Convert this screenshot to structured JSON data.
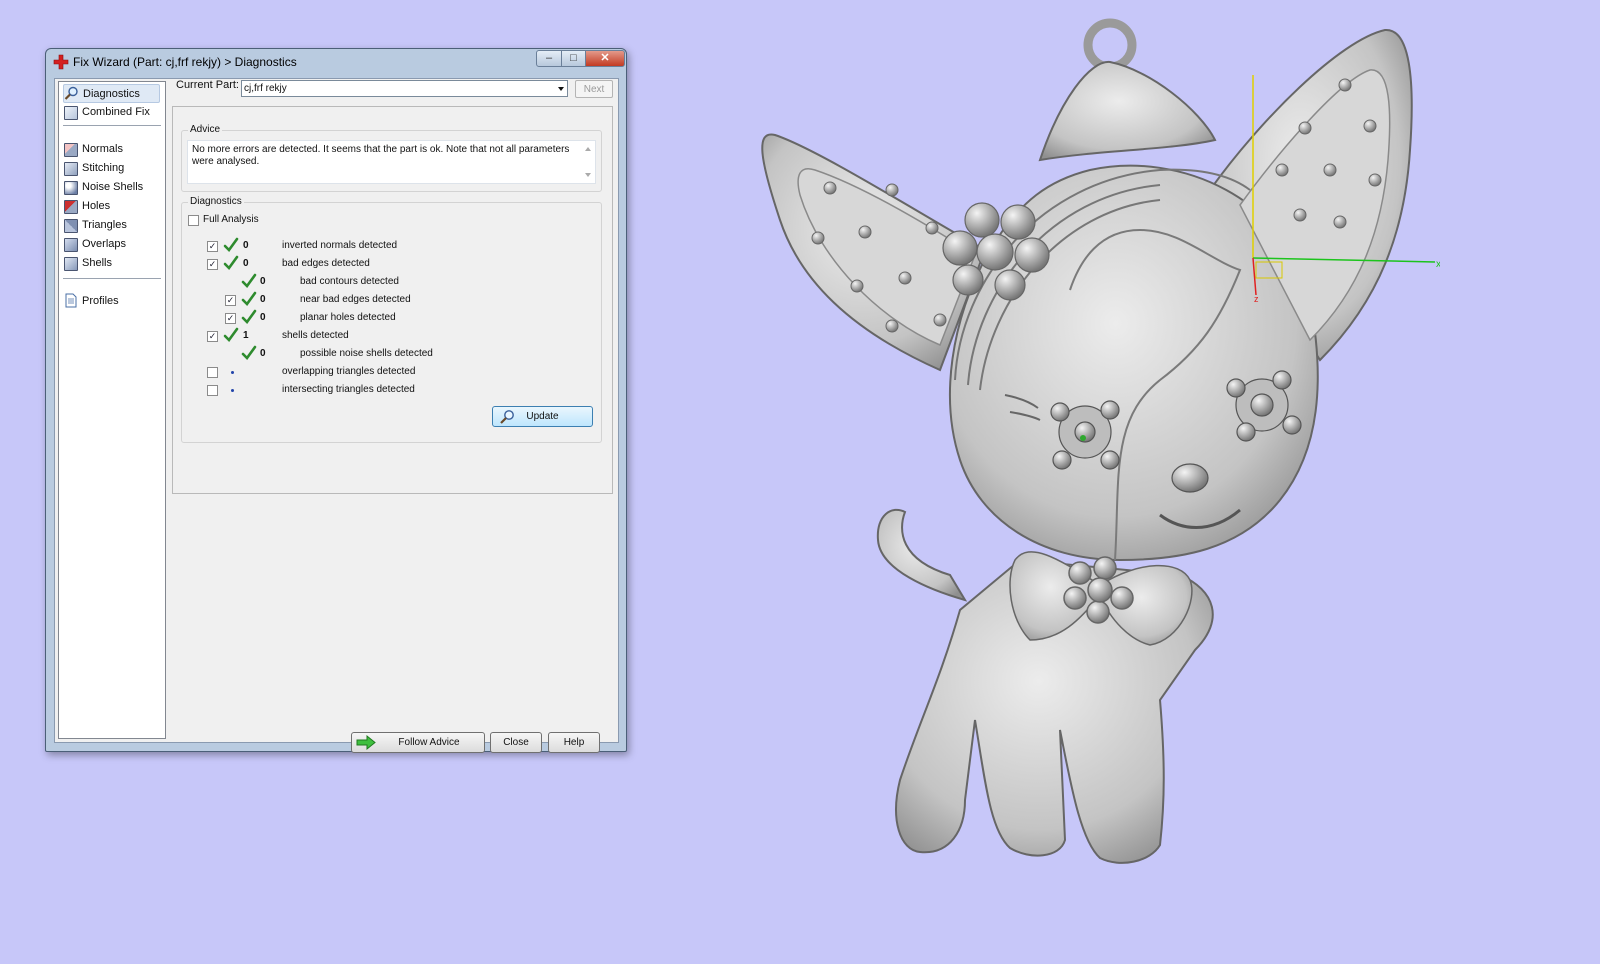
{
  "window": {
    "title": "Fix Wizard (Part: cj,frf rekjy) > Diagnostics",
    "min_label": "–",
    "max_label": "□",
    "close_label": "✕"
  },
  "nav": {
    "items": [
      {
        "label": "Diagnostics",
        "icon": "magnifier-icon",
        "selected": true
      },
      {
        "label": "Combined Fix",
        "icon": "cube-icon"
      },
      {
        "label": "Normals",
        "icon": "normals-cube-icon"
      },
      {
        "label": "Stitching",
        "icon": "stitching-cube-icon"
      },
      {
        "label": "Noise Shells",
        "icon": "noise-shells-icon"
      },
      {
        "label": "Holes",
        "icon": "holes-cube-icon"
      },
      {
        "label": "Triangles",
        "icon": "triangles-cube-icon"
      },
      {
        "label": "Overlaps",
        "icon": "overlaps-cube-icon"
      },
      {
        "label": "Shells",
        "icon": "shells-cube-icon"
      },
      {
        "label": "Profiles",
        "icon": "document-icon"
      }
    ]
  },
  "current_part": {
    "label": "Current Part:",
    "value": "cj,frf rekjy",
    "next_label": "Next"
  },
  "advice": {
    "title": "Advice",
    "text": "No more errors are detected. It seems that the part is ok. Note that not all parameters were analysed."
  },
  "diagnostics": {
    "title": "Diagnostics",
    "full_analysis_label": "Full Analysis",
    "full_analysis_checked": false,
    "rows": [
      {
        "checked": true,
        "status": "ok",
        "count": "0",
        "label": "inverted normals detected",
        "indent": 0,
        "has_checkbox": true
      },
      {
        "checked": true,
        "status": "ok",
        "count": "0",
        "label": "bad edges detected",
        "indent": 0,
        "has_checkbox": true
      },
      {
        "checked": false,
        "status": "ok",
        "count": "0",
        "label": "bad contours detected",
        "indent": 1,
        "has_checkbox": false
      },
      {
        "checked": true,
        "status": "ok",
        "count": "0",
        "label": "near bad edges detected",
        "indent": 1,
        "has_checkbox": true
      },
      {
        "checked": true,
        "status": "ok",
        "count": "0",
        "label": "planar holes detected",
        "indent": 1,
        "has_checkbox": true
      },
      {
        "checked": true,
        "status": "ok",
        "count": "1",
        "label": "shells detected",
        "indent": 0,
        "has_checkbox": true
      },
      {
        "checked": false,
        "status": "ok",
        "count": "0",
        "label": "possible noise shells detected",
        "indent": 1,
        "has_checkbox": false
      },
      {
        "checked": false,
        "status": "pending",
        "count": "",
        "label": "overlapping triangles detected",
        "indent": 0,
        "has_checkbox": true
      },
      {
        "checked": false,
        "status": "pending",
        "count": "",
        "label": "intersecting triangles detected",
        "indent": 0,
        "has_checkbox": true
      }
    ],
    "update_label": "Update"
  },
  "buttons": {
    "follow_advice": "Follow Advice",
    "close": "Close",
    "help": "Help"
  },
  "viewport": {
    "axis_x_label": "x",
    "axis_z_label": "z",
    "background": "#c7c7f9",
    "model_color": "#c9c9c9"
  },
  "colors": {
    "tick": "#2e8b2e",
    "accent": "#3c7fb1"
  }
}
